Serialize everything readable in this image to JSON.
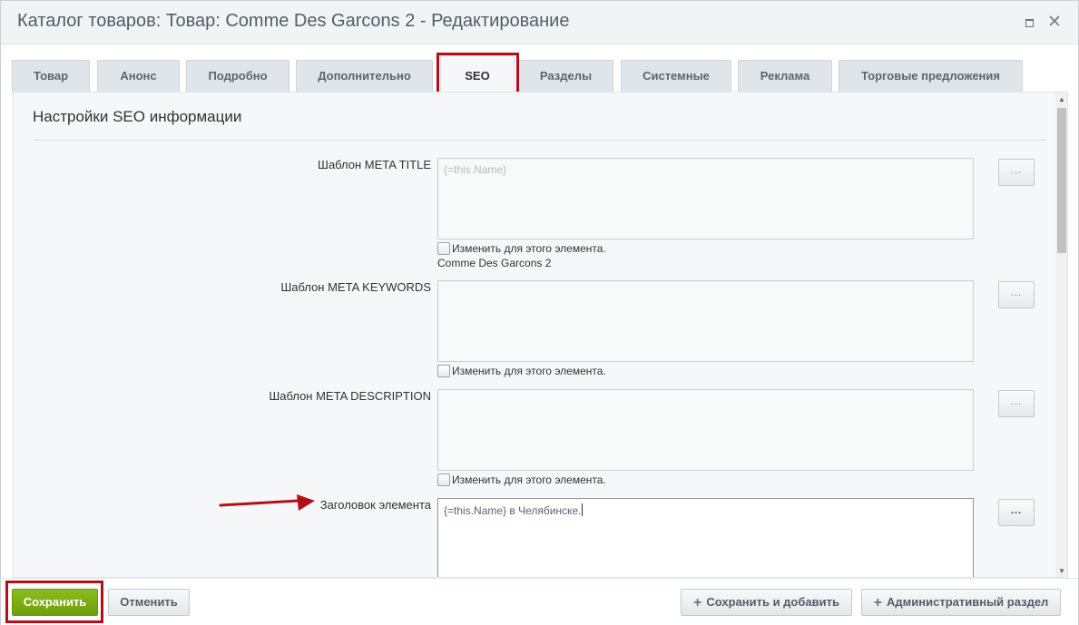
{
  "window": {
    "title": "Каталог товаров: Товар: Comme Des Garcons 2 - Редактирование",
    "maximize_icon": "maximize-icon",
    "close_icon": "close-icon"
  },
  "tabs": [
    {
      "label": "Товар"
    },
    {
      "label": "Анонс"
    },
    {
      "label": "Подробно"
    },
    {
      "label": "Дополнительно"
    },
    {
      "label": "SEO",
      "active": true
    },
    {
      "label": "Разделы"
    },
    {
      "label": "Системные"
    },
    {
      "label": "Реклама"
    },
    {
      "label": "Торговые предложения"
    }
  ],
  "section": {
    "title": "Настройки SEO информации"
  },
  "fields": {
    "meta_title": {
      "label": "Шаблон META TITLE",
      "value": "{=this.Name}",
      "checkbox_label": "Изменить для этого элемента.",
      "computed_value": "Comme Des Garcons 2",
      "button_label": "..."
    },
    "meta_keywords": {
      "label": "Шаблон META KEYWORDS",
      "value": "",
      "checkbox_label": "Изменить для этого элемента.",
      "button_label": "..."
    },
    "meta_description": {
      "label": "Шаблон META DESCRIPTION",
      "value": "",
      "checkbox_label": "Изменить для этого элемента.",
      "button_label": "..."
    },
    "element_heading": {
      "label": "Заголовок элемента",
      "value": "{=this.Name} в Челябинске.",
      "button_label": "..."
    }
  },
  "footer": {
    "save": "Сохранить",
    "cancel": "Отменить",
    "save_and_add": "Сохранить и добавить",
    "admin_section": "Административный раздел"
  },
  "colors": {
    "highlight": "#b11116",
    "save_button": "#7aab10",
    "arrow": "#b11116"
  }
}
